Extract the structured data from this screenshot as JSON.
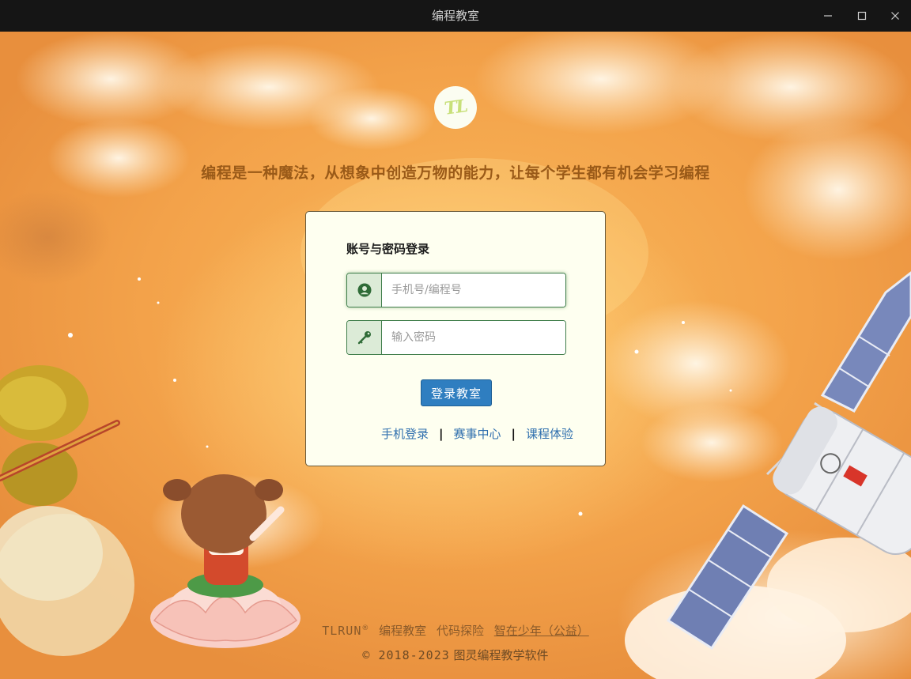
{
  "window": {
    "title": "编程教室"
  },
  "logo": {
    "text": "TL"
  },
  "slogan": "编程是一种魔法，从想象中创造万物的能力，让每个学生都有机会学习编程",
  "login": {
    "title": "账号与密码登录",
    "account_placeholder": "手机号/编程号",
    "password_placeholder": "输入密码",
    "submit_label": "登录教室",
    "links": [
      "手机登录",
      "赛事中心",
      "课程体验"
    ],
    "separator": "|"
  },
  "footer": {
    "brand": "TLRUN",
    "registered": "®",
    "items": [
      "编程教室",
      "代码探险"
    ],
    "link": "智在少年（公益）",
    "copyright": "© 2018-2023",
    "software": "图灵编程教学软件"
  },
  "colors": {
    "titlebar": "#151515",
    "card_bg": "#fefff0",
    "field_border": "#3f7d4a",
    "icon_bg": "#dcebd7",
    "button_bg": "#2f7ec0",
    "link": "#2f6fae",
    "slogan": "#9a5a18"
  },
  "icons": {
    "account": "user-circle-icon",
    "password": "key-icon",
    "minimize": "minimize-icon",
    "maximize": "maximize-icon",
    "close": "close-icon"
  }
}
